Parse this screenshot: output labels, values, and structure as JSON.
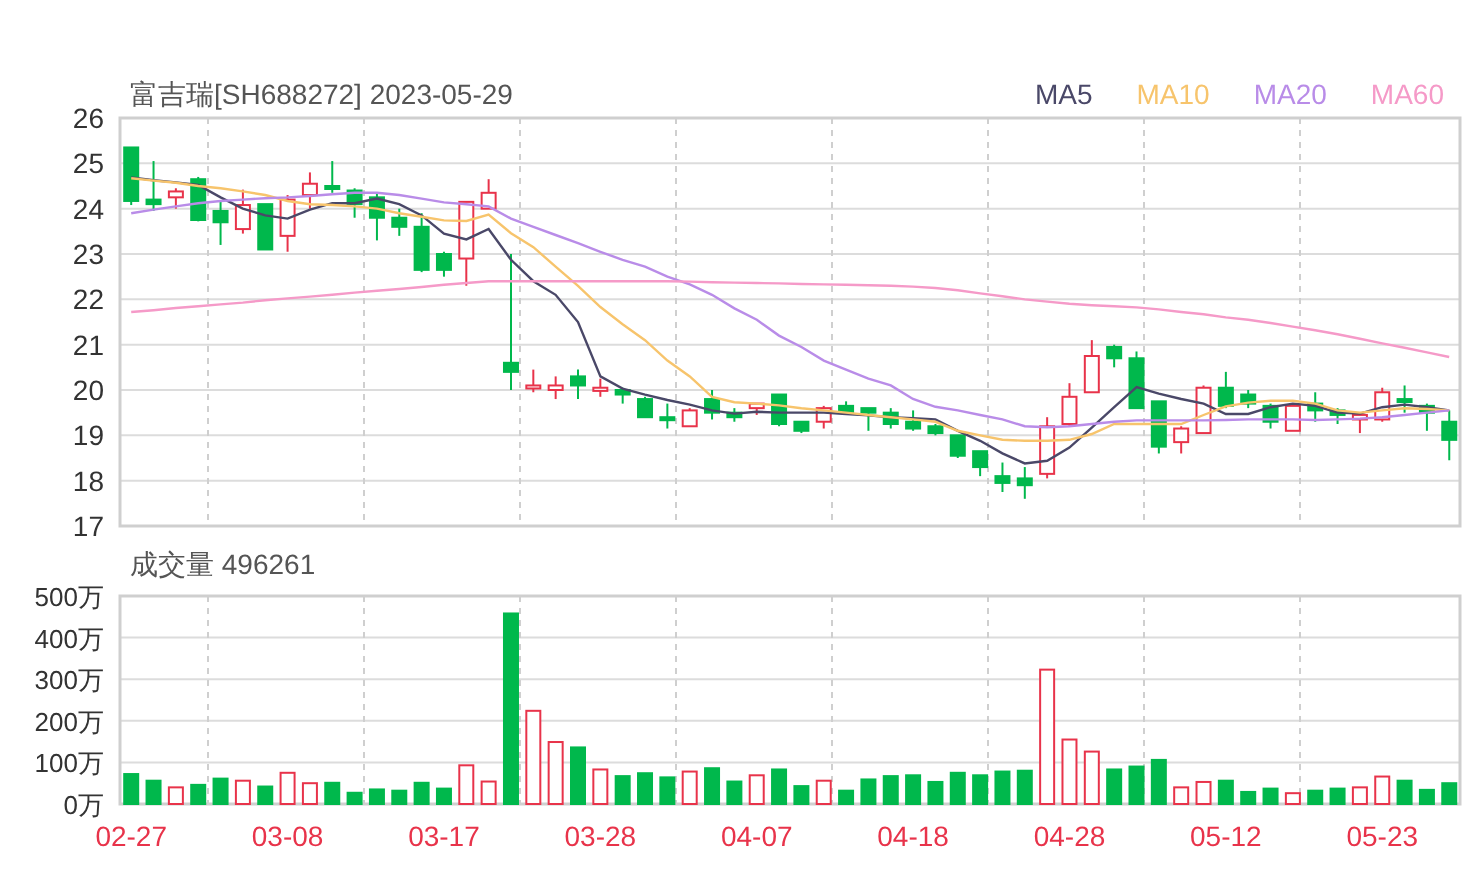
{
  "price_chart": {
    "chart_data": {
      "type": "candlestick",
      "title": "富吉瑞[SH688272] 2023-05-29",
      "ylim": [
        17,
        26
      ],
      "yticks": [
        17,
        18,
        19,
        20,
        21,
        22,
        23,
        24,
        25,
        26
      ],
      "grid": true,
      "categories": [
        null,
        null,
        null,
        null,
        null,
        null,
        null,
        null,
        null,
        null,
        null,
        null,
        null,
        null,
        null,
        null,
        null,
        null,
        null,
        null,
        null,
        null,
        null,
        null,
        null,
        null,
        null,
        null,
        null,
        null,
        null,
        null,
        null,
        null,
        null,
        null,
        null,
        null,
        null,
        null,
        null,
        null,
        null,
        null,
        null,
        null,
        null,
        null,
        null,
        null,
        null,
        null,
        null,
        null,
        null,
        null,
        null,
        null,
        null,
        null
      ],
      "ohlc": [
        [
          25.35,
          25.35,
          24.08,
          24.17
        ],
        [
          24.2,
          25.05,
          23.95,
          24.1
        ],
        [
          24.25,
          24.45,
          24.0,
          24.38
        ],
        [
          24.65,
          24.7,
          23.72,
          23.75
        ],
        [
          23.95,
          24.15,
          23.2,
          23.7
        ],
        [
          23.55,
          24.42,
          23.45,
          24.08
        ],
        [
          24.1,
          24.1,
          23.1,
          23.1
        ],
        [
          23.4,
          24.3,
          23.05,
          24.2
        ],
        [
          24.3,
          24.8,
          24.0,
          24.55
        ],
        [
          24.5,
          25.05,
          24.35,
          24.45
        ],
        [
          24.4,
          24.45,
          23.8,
          24.1
        ],
        [
          24.25,
          24.35,
          23.3,
          23.8
        ],
        [
          23.8,
          24.0,
          23.4,
          23.6
        ],
        [
          23.6,
          23.9,
          22.6,
          22.65
        ],
        [
          23.0,
          23.05,
          22.5,
          22.65
        ],
        [
          22.9,
          24.15,
          22.3,
          24.15
        ],
        [
          24.0,
          24.65,
          24.0,
          24.35
        ],
        [
          20.6,
          23.0,
          20.0,
          20.4
        ],
        [
          20.05,
          20.45,
          19.95,
          20.1
        ],
        [
          20.0,
          20.3,
          19.8,
          20.1
        ],
        [
          20.3,
          20.45,
          19.8,
          20.1
        ],
        [
          19.98,
          20.25,
          19.85,
          20.05
        ],
        [
          20.0,
          20.05,
          19.7,
          19.9
        ],
        [
          19.8,
          19.85,
          19.4,
          19.4
        ],
        [
          19.4,
          19.7,
          19.15,
          19.35
        ],
        [
          19.2,
          19.6,
          19.2,
          19.55
        ],
        [
          19.8,
          20.0,
          19.35,
          19.5
        ],
        [
          19.5,
          19.6,
          19.3,
          19.4
        ],
        [
          19.6,
          19.7,
          19.45,
          19.7
        ],
        [
          19.9,
          19.9,
          19.2,
          19.25
        ],
        [
          19.3,
          19.3,
          19.05,
          19.1
        ],
        [
          19.3,
          19.65,
          19.15,
          19.6
        ],
        [
          19.65,
          19.75,
          19.45,
          19.5
        ],
        [
          19.6,
          19.6,
          19.1,
          19.5
        ],
        [
          19.5,
          19.6,
          19.15,
          19.25
        ],
        [
          19.3,
          19.55,
          19.1,
          19.15
        ],
        [
          19.2,
          19.25,
          19.0,
          19.05
        ],
        [
          19.0,
          19.0,
          18.5,
          18.55
        ],
        [
          18.65,
          18.65,
          18.1,
          18.3
        ],
        [
          18.1,
          18.4,
          17.75,
          17.95
        ],
        [
          18.05,
          18.3,
          17.6,
          17.9
        ],
        [
          18.15,
          19.4,
          18.05,
          19.2
        ],
        [
          19.25,
          20.15,
          19.2,
          19.85
        ],
        [
          19.95,
          21.1,
          19.95,
          20.75
        ],
        [
          20.95,
          21.0,
          20.5,
          20.7
        ],
        [
          20.7,
          20.85,
          19.6,
          19.6
        ],
        [
          19.75,
          19.75,
          18.6,
          18.75
        ],
        [
          18.85,
          19.2,
          18.6,
          19.15
        ],
        [
          19.05,
          20.1,
          19.05,
          20.05
        ],
        [
          20.05,
          20.4,
          19.6,
          19.65
        ],
        [
          19.9,
          20.0,
          19.6,
          19.7
        ],
        [
          19.65,
          19.7,
          19.15,
          19.3
        ],
        [
          19.1,
          19.7,
          19.1,
          19.65
        ],
        [
          19.7,
          19.95,
          19.3,
          19.55
        ],
        [
          19.55,
          19.6,
          19.25,
          19.45
        ],
        [
          19.35,
          19.45,
          19.05,
          19.45
        ],
        [
          19.35,
          20.05,
          19.3,
          19.95
        ],
        [
          19.8,
          20.1,
          19.5,
          19.78
        ],
        [
          19.65,
          19.7,
          19.1,
          19.5
        ],
        [
          19.3,
          19.55,
          18.45,
          18.9
        ]
      ]
    }
  },
  "moving_averages": {
    "chart_data": {
      "type": "line",
      "ylim": [
        17,
        26
      ],
      "categories": [
        null,
        null,
        null,
        null,
        null,
        null,
        null,
        null,
        null,
        null,
        null,
        null,
        null,
        null,
        null,
        null,
        null,
        null,
        null,
        null,
        null,
        null,
        null,
        null,
        null,
        null,
        null,
        null,
        null,
        null,
        null,
        null,
        null,
        null,
        null,
        null,
        null,
        null,
        null,
        null,
        null,
        null,
        null,
        null,
        null,
        null,
        null,
        null,
        null,
        null,
        null,
        null,
        null,
        null,
        null,
        null,
        null,
        null,
        null,
        null
      ],
      "series": [
        {
          "name": "MA5",
          "color": "#4a4868",
          "values": [
            24.69,
            24.63,
            24.58,
            24.52,
            24.25,
            24.0,
            23.85,
            23.78,
            23.98,
            24.12,
            24.12,
            24.22,
            24.1,
            23.85,
            23.45,
            23.32,
            23.55,
            22.87,
            22.4,
            22.1,
            21.5,
            20.3,
            20.03,
            19.9,
            19.78,
            19.68,
            19.55,
            19.48,
            19.52,
            19.5,
            19.5,
            19.5,
            19.47,
            19.44,
            19.4,
            19.38,
            19.35,
            19.1,
            18.88,
            18.6,
            18.38,
            18.44,
            18.73,
            19.17,
            19.62,
            20.06,
            19.92,
            19.8,
            19.7,
            19.47,
            19.47,
            19.62,
            19.7,
            19.65,
            19.5,
            19.48,
            19.62,
            19.68,
            19.62,
            19.55
          ]
        },
        {
          "name": "MA10",
          "color": "#f7c46c",
          "values": [
            24.67,
            24.62,
            24.57,
            24.5,
            24.45,
            24.38,
            24.3,
            24.17,
            24.1,
            24.08,
            24.05,
            24.0,
            23.9,
            23.82,
            23.74,
            23.73,
            23.87,
            23.46,
            23.15,
            22.72,
            22.3,
            21.83,
            21.45,
            21.1,
            20.65,
            20.3,
            19.85,
            19.73,
            19.7,
            19.66,
            19.6,
            19.55,
            19.5,
            19.45,
            19.4,
            19.35,
            19.3,
            19.1,
            19.0,
            18.9,
            18.88,
            18.88,
            18.9,
            19.03,
            19.25,
            19.25,
            19.25,
            19.25,
            19.45,
            19.64,
            19.72,
            19.76,
            19.76,
            19.7,
            19.55,
            19.5,
            19.55,
            19.6,
            19.58,
            19.55
          ]
        },
        {
          "name": "MA20",
          "color": "#b98ce8",
          "values": [
            23.9,
            23.98,
            24.05,
            24.12,
            24.17,
            24.2,
            24.23,
            24.25,
            24.28,
            24.32,
            24.35,
            24.35,
            24.3,
            24.22,
            24.14,
            24.1,
            24.05,
            23.78,
            23.6,
            23.42,
            23.24,
            23.05,
            22.87,
            22.72,
            22.5,
            22.33,
            22.1,
            21.8,
            21.55,
            21.2,
            20.95,
            20.65,
            20.45,
            20.25,
            20.1,
            19.8,
            19.63,
            19.55,
            19.45,
            19.35,
            19.2,
            19.18,
            19.2,
            19.25,
            19.3,
            19.33,
            19.33,
            19.33,
            19.33,
            19.34,
            19.35,
            19.35,
            19.35,
            19.34,
            19.35,
            19.37,
            19.4,
            19.45,
            19.5,
            19.55
          ]
        },
        {
          "name": "MA60",
          "color": "#f59ac8",
          "values": [
            21.72,
            21.76,
            21.81,
            21.85,
            21.89,
            21.93,
            21.98,
            22.02,
            22.06,
            22.1,
            22.15,
            22.19,
            22.23,
            22.27,
            22.32,
            22.36,
            22.4,
            22.4,
            22.4,
            22.4,
            22.4,
            22.4,
            22.4,
            22.4,
            22.4,
            22.39,
            22.38,
            22.37,
            22.36,
            22.35,
            22.34,
            22.33,
            22.32,
            22.31,
            22.3,
            22.28,
            22.25,
            22.2,
            22.13,
            22.07,
            22.0,
            21.95,
            21.9,
            21.87,
            21.85,
            21.82,
            21.78,
            21.72,
            21.67,
            21.6,
            21.55,
            21.48,
            21.4,
            21.32,
            21.23,
            21.13,
            21.03,
            20.93,
            20.83,
            20.73
          ]
        }
      ]
    }
  },
  "volume_chart": {
    "chart_data": {
      "type": "bar",
      "title": "成交量 496261",
      "ylim": [
        0,
        500
      ],
      "grid": true,
      "yticks": [
        {
          "value": 0,
          "label": "0万"
        },
        {
          "value": 100,
          "label": "100万"
        },
        {
          "value": 200,
          "label": "200万"
        },
        {
          "value": 300,
          "label": "300万"
        },
        {
          "value": 400,
          "label": "400万"
        },
        {
          "value": 500,
          "label": "500万"
        }
      ],
      "categories": [
        "02-27",
        null,
        null,
        null,
        null,
        null,
        null,
        "03-08",
        null,
        null,
        null,
        null,
        null,
        null,
        "03-17",
        null,
        null,
        null,
        null,
        null,
        null,
        "03-28",
        null,
        null,
        null,
        null,
        null,
        null,
        "04-07",
        null,
        null,
        null,
        null,
        null,
        null,
        "04-18",
        null,
        null,
        null,
        null,
        null,
        null,
        "04-28",
        null,
        null,
        null,
        null,
        null,
        null,
        "05-12",
        null,
        null,
        null,
        null,
        null,
        null,
        "05-23",
        null,
        null,
        null
      ],
      "values": [
        72,
        56,
        40,
        46,
        61,
        56,
        42,
        75,
        50,
        51,
        27,
        35,
        32,
        51,
        37,
        93,
        54,
        458,
        224,
        149,
        136,
        83,
        67,
        74,
        64,
        78,
        86,
        54,
        69,
        83,
        43,
        56,
        32,
        59,
        67,
        69,
        53,
        75,
        69,
        78,
        80,
        323,
        155,
        126,
        83,
        90,
        106,
        40,
        53,
        56,
        29,
        37,
        26,
        32,
        37,
        40,
        66,
        56,
        34,
        50
      ]
    }
  }
}
